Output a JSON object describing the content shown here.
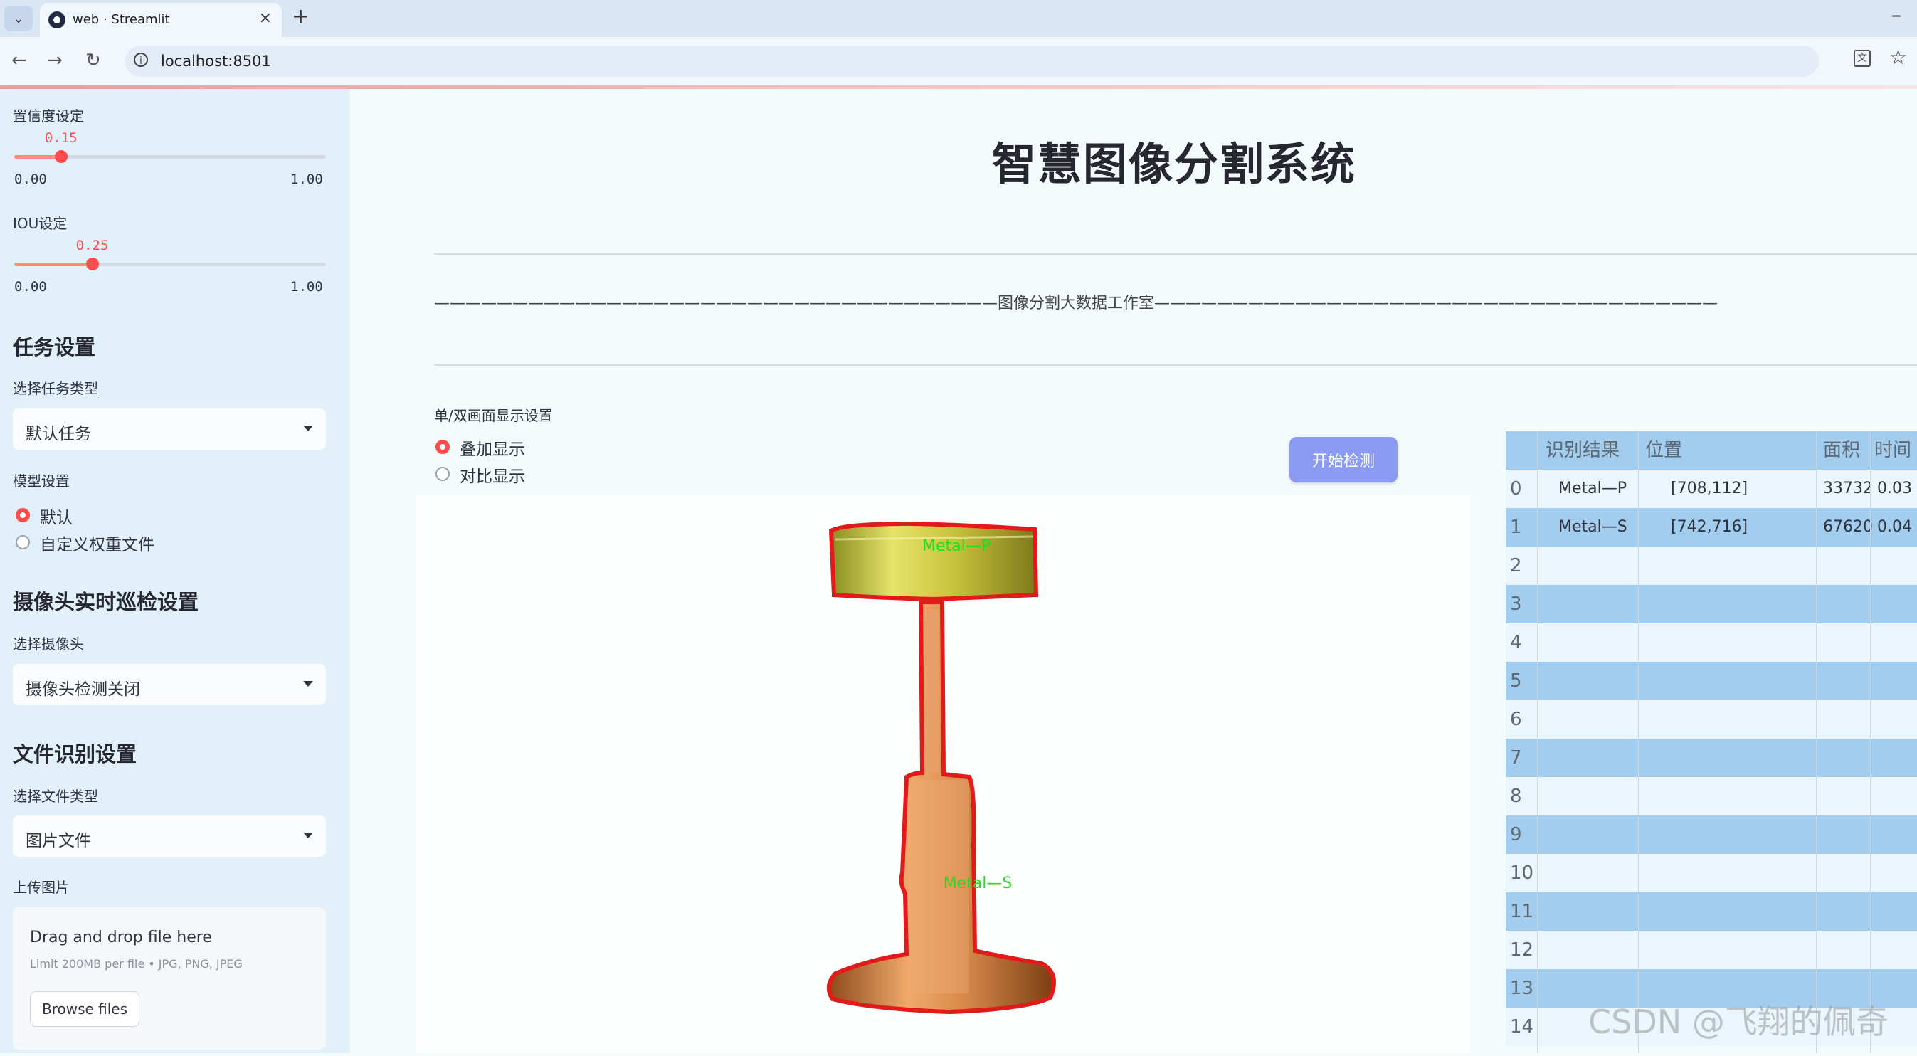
{
  "browser": {
    "tab_title": "web · Streamlit",
    "url": "localhost:8501"
  },
  "sidebar": {
    "confidence": {
      "label": "置信度设定",
      "value": "0.15",
      "level": 0.15,
      "min": "0.00",
      "max": "1.00"
    },
    "iou": {
      "label": "IOU设定",
      "value": "0.25",
      "level": 0.25,
      "min": "0.00",
      "max": "1.00"
    },
    "task_section": {
      "title": "任务设置",
      "select_label": "选择任务类型",
      "selected": "默认任务"
    },
    "model_section": {
      "label": "模型设置",
      "options": [
        "默认",
        "自定义权重文件"
      ],
      "selected_index": 0
    },
    "camera_section": {
      "title": "摄像头实时巡检设置",
      "select_label": "选择摄像头",
      "selected": "摄像头检测关闭"
    },
    "file_section": {
      "title": "文件识别设置",
      "select_label": "选择文件类型",
      "selected": "图片文件"
    },
    "upload": {
      "label": "上传图片",
      "drop_text": "Drag and drop file here",
      "limit_text": "Limit 200MB per file • JPG, PNG, JPEG",
      "browse_label": "Browse files"
    }
  },
  "main": {
    "title": "智慧图像分割系统",
    "divider_text": "————————————————————————————————————图像分割大数据工作室————————————————————————————————————",
    "display_label": "单/双画面显示设置",
    "display_options": [
      "叠加显示",
      "对比显示"
    ],
    "display_selected_index": 0,
    "start_button": "开始检测",
    "image_labels": [
      "Metal—P",
      "Metal—S"
    ]
  },
  "results_table": {
    "columns": [
      "识别结果",
      "位置",
      "面积",
      "时间"
    ],
    "rows": [
      {
        "index": "0",
        "result": "Metal—P",
        "position": "[708,112]",
        "area": "33732",
        "time": "0.03"
      },
      {
        "index": "1",
        "result": "Metal—S",
        "position": "[742,716]",
        "area": "67620",
        "time": "0.04"
      },
      {
        "index": "2",
        "result": "",
        "position": "",
        "area": "",
        "time": ""
      },
      {
        "index": "3",
        "result": "",
        "position": "",
        "area": "",
        "time": ""
      },
      {
        "index": "4",
        "result": "",
        "position": "",
        "area": "",
        "time": ""
      },
      {
        "index": "5",
        "result": "",
        "position": "",
        "area": "",
        "time": ""
      },
      {
        "index": "6",
        "result": "",
        "position": "",
        "area": "",
        "time": ""
      },
      {
        "index": "7",
        "result": "",
        "position": "",
        "area": "",
        "time": ""
      },
      {
        "index": "8",
        "result": "",
        "position": "",
        "area": "",
        "time": ""
      },
      {
        "index": "9",
        "result": "",
        "position": "",
        "area": "",
        "time": ""
      },
      {
        "index": "10",
        "result": "",
        "position": "",
        "area": "",
        "time": ""
      },
      {
        "index": "11",
        "result": "",
        "position": "",
        "area": "",
        "time": ""
      },
      {
        "index": "12",
        "result": "",
        "position": "",
        "area": "",
        "time": ""
      },
      {
        "index": "13",
        "result": "",
        "position": "",
        "area": "",
        "time": ""
      },
      {
        "index": "14",
        "result": "",
        "position": "",
        "area": "",
        "time": ""
      }
    ]
  },
  "watermark": "CSDN @飞翔的佩奇",
  "colors": {
    "accent": "#ff4b4b",
    "button": "#8b9bf3",
    "table_header": "#a3cdef",
    "mask_outline": "#e11a1a",
    "label_green": "#22dd22"
  },
  "icons": [
    "chevron-down-icon",
    "close-icon",
    "plus-icon",
    "minimize-icon",
    "back-icon",
    "forward-icon",
    "reload-icon",
    "site-info-icon",
    "translate-icon",
    "star-icon"
  ]
}
